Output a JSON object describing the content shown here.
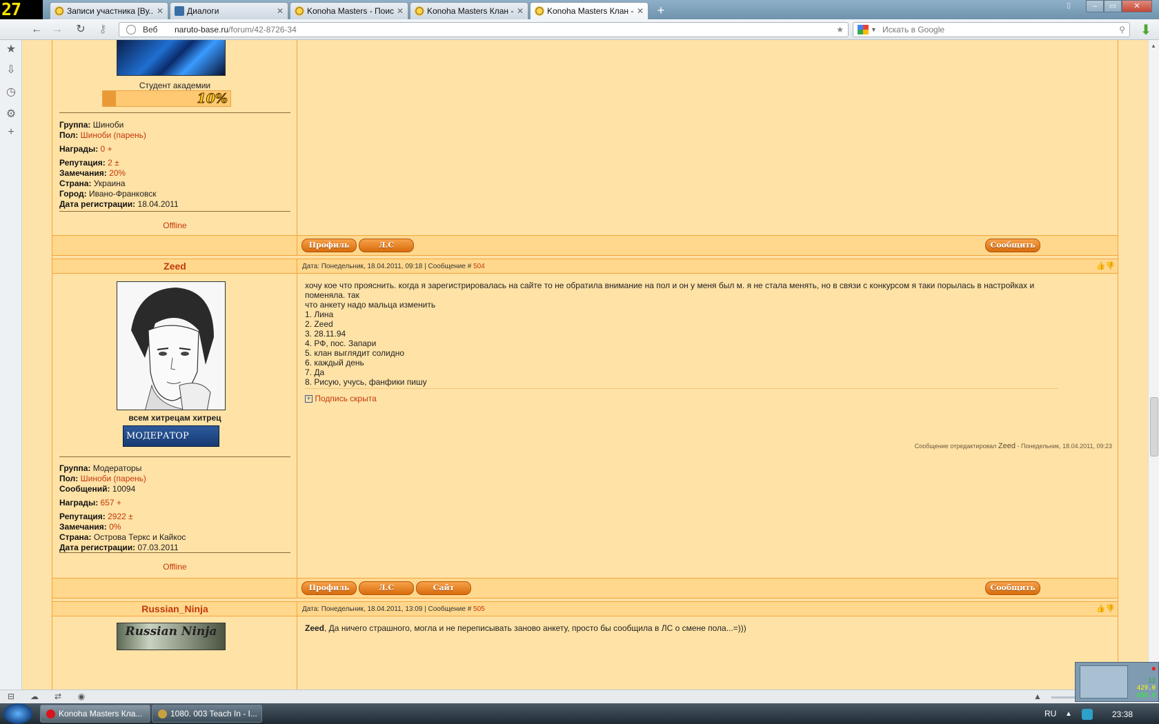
{
  "fps_counter": "27",
  "tabs": [
    {
      "title": "Записи участника [Ву..."
    },
    {
      "title": "Диалоги"
    },
    {
      "title": "Konoha Masters - Поиск"
    },
    {
      "title": "Konoha Masters Клан -..."
    },
    {
      "title": "Konoha Masters Клан -..."
    }
  ],
  "address": {
    "scheme_label": "Веб",
    "host": "naruto-base.ru",
    "path": "/forum/42-8726-34"
  },
  "search": {
    "placeholder": "Искать в Google"
  },
  "post_prev": {
    "rank": "Студент академии",
    "rank_percent": 10,
    "rank_label": "10%",
    "fields": {
      "group_label": "Группа:",
      "group": "Шиноби",
      "gender_label": "Пол:",
      "gender": "Шиноби (парень)",
      "awards_label": "Награды:",
      "awards": "0",
      "awards_plus": "+",
      "rep_label": "Репутация:",
      "rep": "2",
      "rep_pm": "±",
      "warn_label": "Замечания:",
      "warn": "20%",
      "country_label": "Страна:",
      "country": "Украина",
      "city_label": "Город:",
      "city": "Ивано-Франковск",
      "reg_label": "Дата регистрации:",
      "reg": "18.04.2011"
    },
    "status": "Offline",
    "buttons": {
      "profile": "Профиль",
      "pm": "Л.С",
      "report": "Сообщить"
    }
  },
  "post_504": {
    "author": "Zeed",
    "meta_prefix": "Дата: Понедельник, 18.04.2011, 09:18 | Сообщение #",
    "msg_no": "504",
    "text_lines": [
      "хочу кое что прояснить. когда я зарегистрировалась на сайте то не обратила внимание на пол и он у меня был м. я не стала менять, но в связи с конкурсом я таки порылась в настройках и поменяла. так",
      "что анкету надо мальца изменить",
      "1. Лина",
      "2. Zeed",
      "3. 28.11.94",
      "4. РФ, пос. Запари",
      "5. клан выглядит солидно",
      "6. каждый день",
      "7. Да",
      "8. Рисую, учусь, фанфики пишу"
    ],
    "signature_hidden": "Подпись скрыта",
    "edit_prefix": "Сообщение отредактировал",
    "edit_user": "Zeed",
    "edit_suffix": "- Понедельник, 18.04.2011, 09:23",
    "user_title": "всем хитрецам хитрец",
    "badge": "МОДЕРАТОР",
    "fields": {
      "group_label": "Группа:",
      "group": "Модераторы",
      "gender_label": "Пол:",
      "gender": "Шиноби (парень)",
      "posts_label": "Сообщений:",
      "posts": "10094",
      "awards_label": "Награды:",
      "awards": "657",
      "awards_plus": "+",
      "rep_label": "Репутация:",
      "rep": "2922",
      "rep_pm": "±",
      "warn_label": "Замечания:",
      "warn": "0%",
      "country_label": "Страна:",
      "country": "Острова Теркс и Кайкос",
      "reg_label": "Дата регистрации:",
      "reg": "07.03.2011"
    },
    "status": "Offline",
    "buttons": {
      "profile": "Профиль",
      "pm": "Л.С",
      "site": "Сайт",
      "report": "Сообщить"
    }
  },
  "post_505": {
    "author": "Russian_Ninja",
    "avatar_text": "Russian Ninja",
    "meta_prefix": "Дата: Понедельник, 18.04.2011, 13:09 | Сообщение #",
    "msg_no": "505",
    "reply_to": "Zeed",
    "text": ", Да ничего страшного, могла и не переписывать заново анкету, просто бы сообщила в ЛС о смене пола...=)))"
  },
  "taskbar": {
    "items": [
      {
        "label": "Konoha Masters Кла..."
      },
      {
        "label": "1080. 003 Teach In - I..."
      }
    ],
    "lang": "RU",
    "clock": "23:38"
  },
  "widget": {
    "v1": "12",
    "v2": "429.0",
    "v3": "656.0"
  }
}
